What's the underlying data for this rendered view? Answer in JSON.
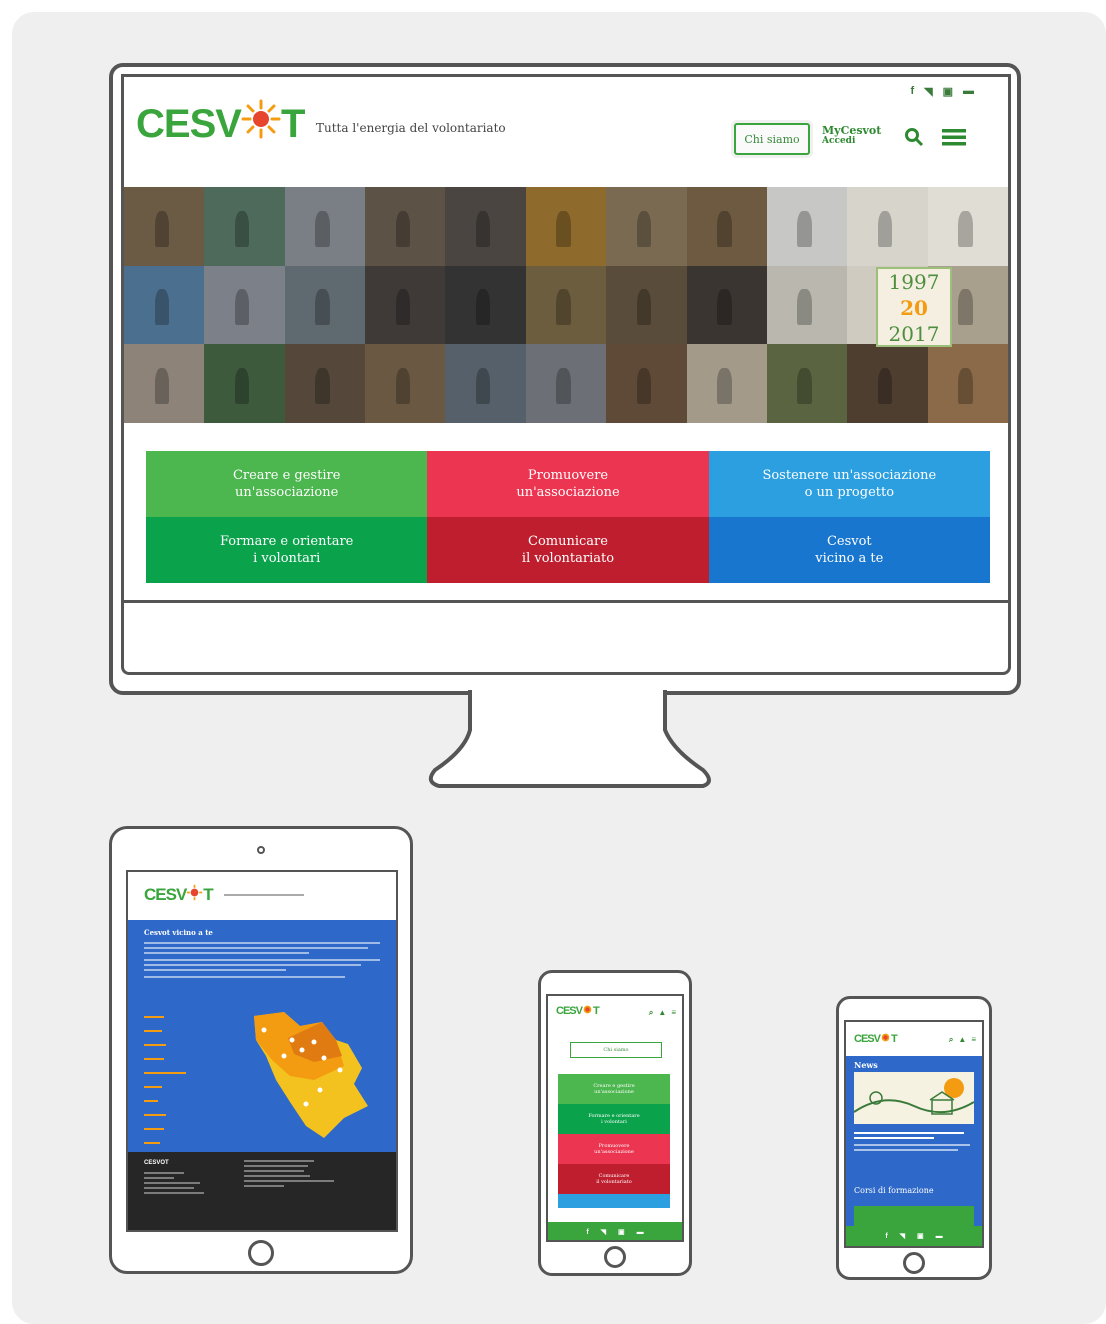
{
  "brand": {
    "name": "CESVOT",
    "logo_left": "CESV",
    "logo_right": "T",
    "tagline": "Tutta l'energia del volontariato",
    "green": "#3aa53c"
  },
  "desktop": {
    "social_icons": [
      "facebook-icon",
      "twitter-icon",
      "youtube-icon",
      "email-icon"
    ],
    "social_glyphs": [
      "f",
      "◥",
      "▣",
      "▬"
    ],
    "chi_siamo": "Chi siamo",
    "mycesvot": "MyCesvot",
    "accedi": "Accedi",
    "anniversary": {
      "start": "1997",
      "middle": "20",
      "end": "2017"
    },
    "categories": [
      {
        "label": "Creare e gestire\nun'associazione",
        "color": "#4cb64f"
      },
      {
        "label": "Promuovere\nun'associazione",
        "color": "#ec3550"
      },
      {
        "label": "Sostenere un'associazione\no un progetto",
        "color": "#2b9fe0"
      },
      {
        "label": "Formare e orientare\ni volontari",
        "color": "#0aa34b"
      },
      {
        "label": "Comunicare\nil volontariato",
        "color": "#bf1e2e"
      },
      {
        "label": "Cesvot\nvicino a te",
        "color": "#1876cf"
      }
    ]
  },
  "tablet": {
    "section_title": "Cesvot vicino a te",
    "footer_logo": "CESVOT"
  },
  "phone1": {
    "chi_siamo": "Chi siamo",
    "categories": [
      {
        "label": "Creare e gestire\nun'associazione",
        "color": "#4cb64f"
      },
      {
        "label": "Formare e orientare\ni volontari",
        "color": "#0aa34b"
      },
      {
        "label": "Promuovere\nun'associazione",
        "color": "#ec3550"
      },
      {
        "label": "Comunicare\nil volontariato",
        "color": "#bf1e2e"
      },
      {
        "label": "",
        "color": "#2b9fe0"
      }
    ]
  },
  "phone2": {
    "news_title": "News",
    "courses_title": "Corsi di formazione"
  }
}
